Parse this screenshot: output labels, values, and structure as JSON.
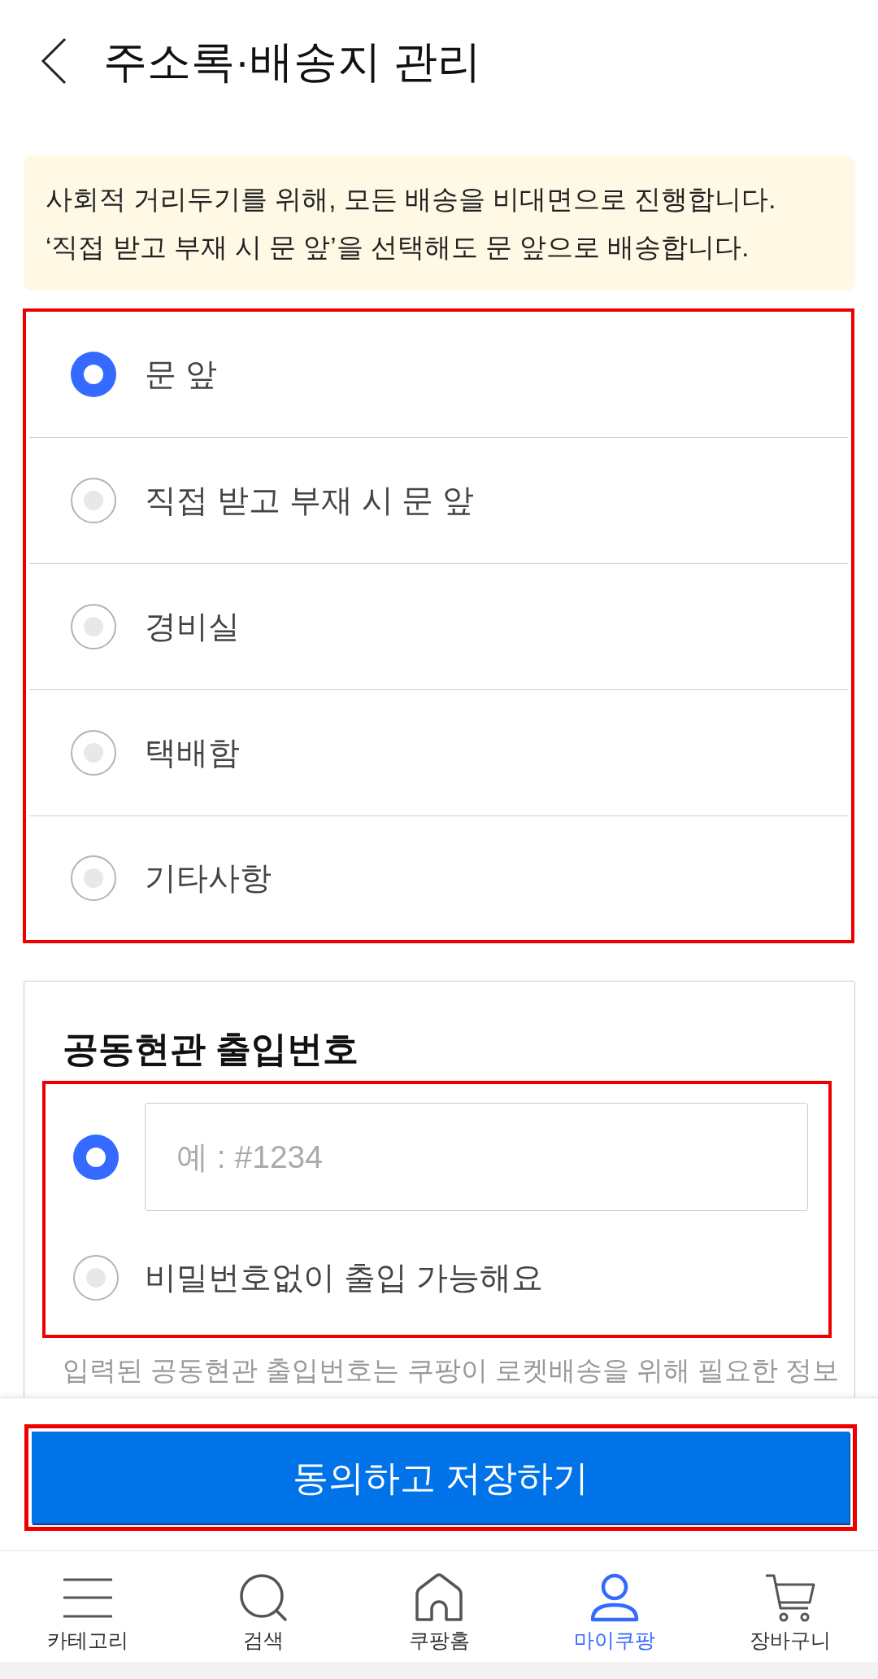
{
  "header": {
    "title": "주소록·배송지 관리"
  },
  "notice": {
    "lines": [
      "사회적 거리두기를 위해, 모든 배송을 비대면으로 진행합니다.",
      "‘직접 받고 부재 시 문 앞’을 선택해도 문 앞으로 배송합니다."
    ]
  },
  "delivery_options": {
    "highlighted": true,
    "options": [
      {
        "label": "문 앞",
        "selected": true
      },
      {
        "label": "직접 받고 부재 시 문 앞",
        "selected": false
      },
      {
        "label": "경비실",
        "selected": false
      },
      {
        "label": "택배함",
        "selected": false
      },
      {
        "label": "기타사항",
        "selected": false
      }
    ]
  },
  "entrance_code": {
    "title": "공동현관 출입번호",
    "highlighted": true,
    "options": [
      {
        "kind": "input",
        "placeholder": "예 : #1234",
        "selected": true
      },
      {
        "kind": "label",
        "label": "비밀번호없이 출입 가능해요",
        "selected": false
      }
    ],
    "note": "입력된 공동현관 출입번호는 쿠팡이 로켓배송을 위해 필요한 정보"
  },
  "save_button": {
    "label": "동의하고 저장하기",
    "highlighted": true
  },
  "bottom_nav": [
    {
      "kind": "menu",
      "label": "카테고리",
      "selected": false
    },
    {
      "kind": "search",
      "label": "검색",
      "selected": false
    },
    {
      "kind": "home",
      "label": "쿠팡홈",
      "selected": false
    },
    {
      "kind": "account",
      "label": "마이쿠팡",
      "selected": true
    },
    {
      "kind": "cart",
      "label": "장바구니",
      "selected": false
    }
  ]
}
